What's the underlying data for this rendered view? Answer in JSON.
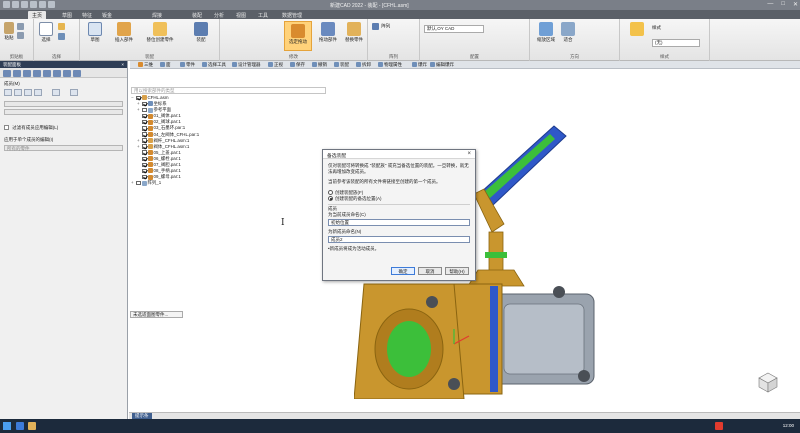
{
  "app": {
    "title": "新建CAD 2022 - 装配 - [CFHL.asm]",
    "window_controls": [
      "—",
      "□",
      "✕"
    ]
  },
  "ribbon_tabs": [
    "主页",
    "草图",
    "特征",
    "钣金",
    "焊接",
    "装配",
    "分析",
    "视图",
    "工具",
    "数据管理"
  ],
  "ribbon": {
    "groups": [
      {
        "label": "剪贴板",
        "buttons": [
          "粘贴",
          "剪切",
          "复制"
        ]
      },
      {
        "label": "选择",
        "buttons": [
          "选择"
        ]
      },
      {
        "label": "装配",
        "buttons": [
          "草图",
          "插入部件",
          "替位创建零件",
          "装配"
        ]
      },
      {
        "label": "修改",
        "buttons": [
          "选定拖动",
          "拖动部件",
          "替换零件"
        ]
      },
      {
        "label": "阵列",
        "buttons": [
          "阵列"
        ]
      },
      {
        "label": "配置",
        "buttons": [
          "默认,OY CAD"
        ]
      },
      {
        "label": "方向",
        "buttons": [
          "缩放区域",
          "适合"
        ]
      },
      {
        "label": "样式",
        "buttons": [
          "样式"
        ]
      }
    ],
    "style_dropdown": "(无)"
  },
  "context_toolbar": [
    "三维",
    "面",
    "零件",
    "选择工具",
    "设计管理器",
    "正视",
    "保存",
    "撤销",
    "装配",
    "拆卸",
    "物理属性",
    "爆炸",
    "编辑爆炸"
  ],
  "left_panel": {
    "header": "装配面板",
    "section_label": "成员(M)",
    "filter_label": "过滤有成员应用编辑(L)",
    "apply_label": "应用于单个成员的编辑(I)",
    "apply_value": "所有的零件"
  },
  "tree": {
    "search_placeholder": "用以搜索部件的类型",
    "nodes": [
      {
        "label": "CFHL.asm",
        "level": 0,
        "exp": "−",
        "checked": true,
        "color": "#d9a14a"
      },
      {
        "label": "坐标系",
        "level": 1,
        "exp": "+",
        "checked": true,
        "color": "#6f8fb9"
      },
      {
        "label": "参考平面",
        "level": 1,
        "exp": "+",
        "checked": false,
        "color": "#8aa7c9"
      },
      {
        "label": "01_阀体.par:1",
        "level": 1,
        "exp": "",
        "checked": true,
        "color": "#d38a30"
      },
      {
        "label": "02_阀球.par:1",
        "level": 1,
        "exp": "",
        "checked": true,
        "color": "#d38a30"
      },
      {
        "label": "03_石墨环.par:1",
        "level": 1,
        "exp": "",
        "checked": true,
        "color": "#d38a30"
      },
      {
        "label": "04_左阀体_CFHL.par:1",
        "level": 1,
        "exp": "",
        "checked": true,
        "color": "#d38a30"
      },
      {
        "label": "阀杆_CFHL.asm:1",
        "level": 1,
        "exp": "+",
        "checked": true,
        "color": "#d9a14a"
      },
      {
        "label": "阀体_CFHL.asm:1",
        "level": 1,
        "exp": "+",
        "checked": true,
        "color": "#d9a14a"
      },
      {
        "label": "05_上盖.par:1",
        "level": 1,
        "exp": "",
        "checked": true,
        "color": "#d38a30"
      },
      {
        "label": "06_螺栓.par:1",
        "level": 1,
        "exp": "",
        "checked": true,
        "color": "#d38a30"
      },
      {
        "label": "07_阀胆.par:1",
        "level": 1,
        "exp": "",
        "checked": true,
        "color": "#d38a30"
      },
      {
        "label": "08_手柄.par:1",
        "level": 1,
        "exp": "",
        "checked": true,
        "color": "#d38a30"
      },
      {
        "label": "09_螺母.par:1",
        "level": 1,
        "exp": "",
        "checked": true,
        "color": "#d38a30"
      },
      {
        "label": "阵列_1",
        "level": 0,
        "exp": "+",
        "checked": false,
        "color": "#8aa7c9"
      }
    ],
    "file_label": "未选适面图零件..."
  },
  "dialog": {
    "title": "备选装配",
    "intro": "仅对装配可将转换成 \"装配族\" 或充当备选位置的装配。一旦转换，就无法再增加改变成员。",
    "scope": "当前参考该装配的所有文件将链接至创建的第一个成员。",
    "option1": "创建装配族(F)",
    "option2": "创建装配的备选位置(A)",
    "member_section": "成员",
    "current_member_label": "为当前成员命名(C)",
    "current_member_value": "初始位置",
    "new_member_label": "为新成员命名(N)",
    "new_member_value": "成员2",
    "note": "•新成员将成为活动成员。",
    "ok": "确定",
    "cancel": "取消",
    "help": "帮助(H)"
  },
  "status": {
    "tab": "提示条"
  },
  "taskbar": {
    "clock": "12:00"
  },
  "colors": {
    "accent": "#3d7bd9",
    "ribbon_active": "#ffd27a",
    "brass": "#c9962e",
    "steel": "#9aa3ae",
    "valve_blue": "#2f58c8",
    "valve_green": "#3cbf3a"
  }
}
